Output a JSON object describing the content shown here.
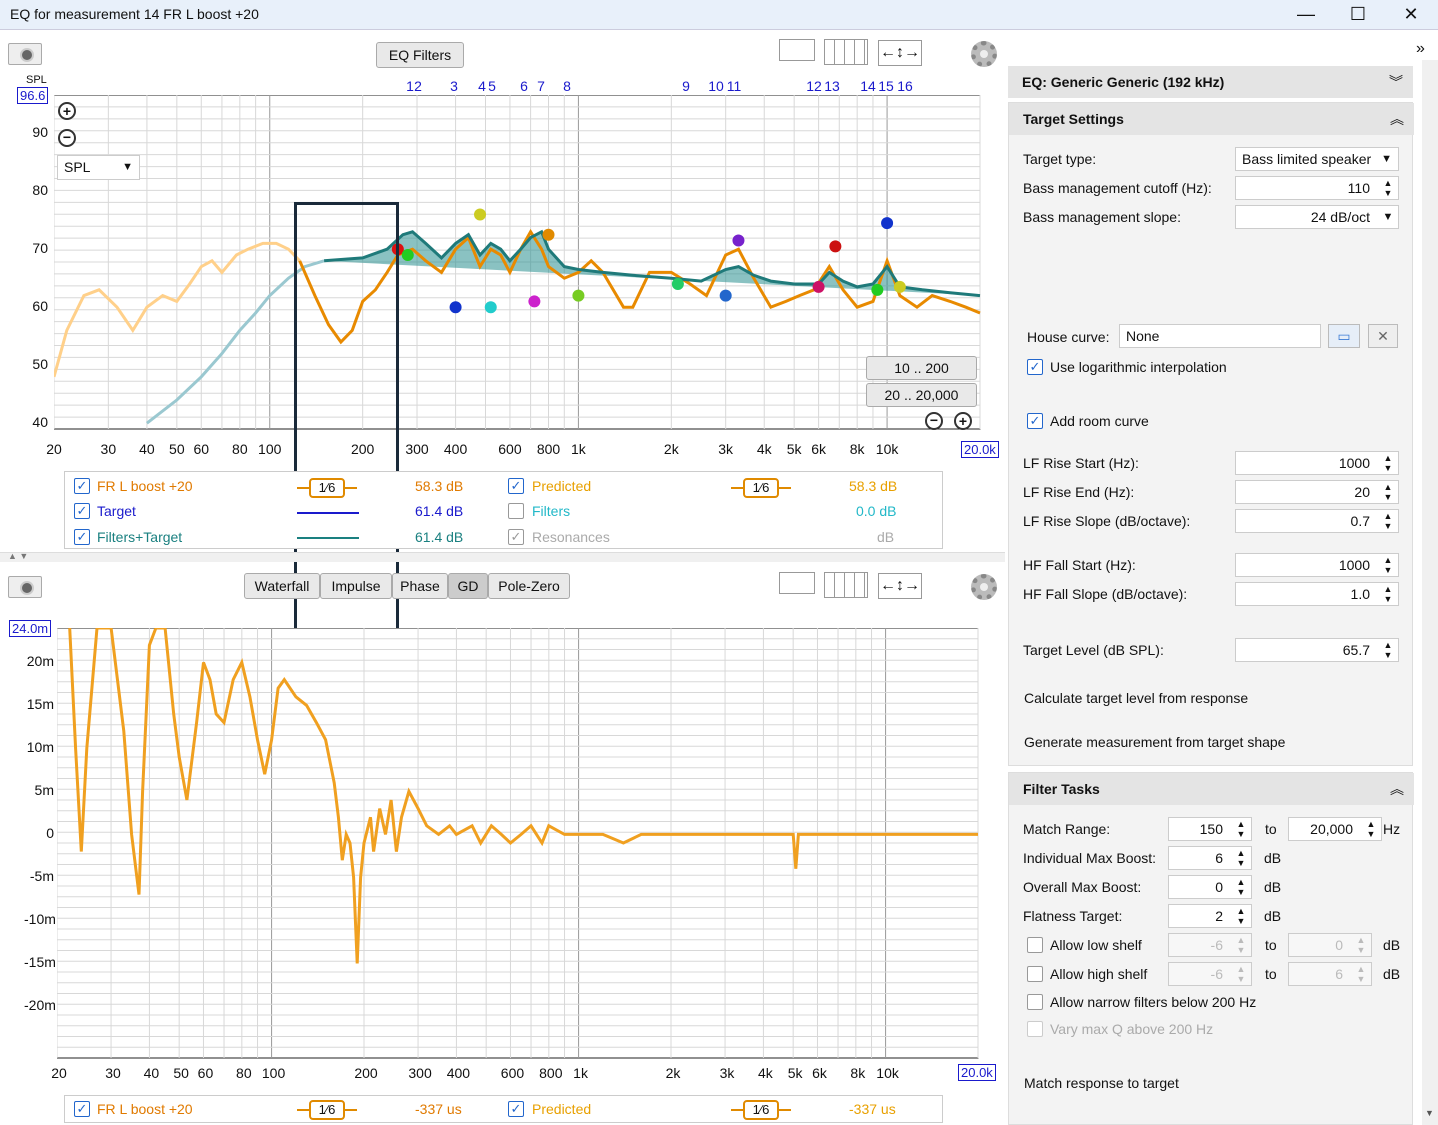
{
  "window": {
    "title": "EQ for measurement 14 FR L boost +20",
    "min": "—",
    "max": "☐",
    "close": "✕"
  },
  "top": {
    "eq_filters": "EQ Filters",
    "spl_dropdown": "SPL",
    "spl_axis_top": "96.6",
    "spl_unit": "SPL",
    "y_ticks": [
      "90",
      "80",
      "70",
      "60",
      "50",
      "40"
    ],
    "x_ticks": [
      "20",
      "30",
      "40",
      "50",
      "60",
      "80",
      "100",
      "200",
      "300",
      "400",
      "600",
      "800",
      "1k",
      "2k",
      "3k",
      "4k",
      "5k",
      "6k",
      "8k",
      "10k"
    ],
    "x_end": "20.0k",
    "filter_numbers": [
      "1",
      "2",
      "3",
      "4",
      "5",
      "6",
      "7",
      "8",
      "9",
      "10",
      "11",
      "12",
      "13",
      "14",
      "15",
      "16"
    ],
    "range_a": "10 .. 200",
    "range_b": "20 .. 20,000"
  },
  "top_legend": [
    {
      "label": "FR L boost +20",
      "checked": true,
      "smoothing": "1⁄6",
      "value": "58.3 dB",
      "color": "#e07a00"
    },
    {
      "label": "Target",
      "checked": true,
      "value": "61.4 dB",
      "color": "#1a1acc"
    },
    {
      "label": "Filters+Target",
      "checked": true,
      "value": "61.4 dB",
      "color": "#1a8080"
    },
    {
      "label": "Predicted",
      "checked": true,
      "smoothing": "1⁄6",
      "value": "58.3 dB",
      "color": "#e8a000"
    },
    {
      "label": "Filters",
      "checked": false,
      "value": "0.0 dB",
      "color": "#22b8c8"
    },
    {
      "label": "Resonances",
      "checked": true,
      "value": "dB",
      "color": "#aaaaaa"
    }
  ],
  "bottom": {
    "tabs": [
      "Waterfall",
      "Impulse",
      "Phase",
      "GD",
      "Pole-Zero"
    ],
    "active_tab": "GD",
    "y_axis_top": "24.0m",
    "y_ticks": [
      "20m",
      "15m",
      "10m",
      "5m",
      "0",
      "-5m",
      "-10m",
      "-15m",
      "-20m"
    ],
    "x_ticks": [
      "20",
      "30",
      "40",
      "50",
      "60",
      "80",
      "100",
      "200",
      "300",
      "400",
      "600",
      "800",
      "1k",
      "2k",
      "3k",
      "4k",
      "5k",
      "6k",
      "8k",
      "10k"
    ],
    "x_end": "20.0k"
  },
  "bottom_legend": [
    {
      "label": "FR L boost +20",
      "checked": true,
      "smoothing": "1⁄6",
      "value": "-337 us"
    },
    {
      "label": "Predicted",
      "checked": true,
      "smoothing": "1⁄6",
      "value": "-337 us"
    }
  ],
  "panel": {
    "eq_header": "EQ: Generic Generic (192 kHz)",
    "target_header": "Target Settings",
    "target_type_label": "Target type:",
    "target_type": "Bass limited speaker",
    "bm_cutoff_label": "Bass management cutoff (Hz):",
    "bm_cutoff": "110",
    "bm_slope_label": "Bass management slope:",
    "bm_slope": "24 dB/oct",
    "house_curve_label": "House curve:",
    "house_curve": "None",
    "log_interp": "Use logarithmic interpolation",
    "add_room": "Add room curve",
    "lf_rise_start_label": "LF Rise Start (Hz):",
    "lf_rise_start": "1000",
    "lf_rise_end_label": "LF Rise End (Hz):",
    "lf_rise_end": "20",
    "lf_rise_slope_label": "LF Rise Slope (dB/octave):",
    "lf_rise_slope": "0.7",
    "hf_fall_start_label": "HF Fall Start (Hz):",
    "hf_fall_start": "1000",
    "hf_fall_slope_label": "HF Fall Slope (dB/octave):",
    "hf_fall_slope": "1.0",
    "target_level_label": "Target Level (dB SPL):",
    "target_level": "65.7",
    "calc_target": "Calculate target level from response",
    "gen_meas": "Generate measurement from target shape",
    "filter_header": "Filter Tasks",
    "match_range_label": "Match Range:",
    "match_from": "150",
    "to": "to",
    "match_to": "20,000",
    "hz": "Hz",
    "ind_max_label": "Individual Max Boost:",
    "ind_max": "6",
    "db": "dB",
    "overall_max_label": "Overall Max Boost:",
    "overall_max": "0",
    "flatness_label": "Flatness Target:",
    "flatness": "2",
    "low_shelf": "Allow low shelf",
    "low_a": "-6",
    "low_b": "0",
    "high_shelf": "Allow high shelf",
    "high_a": "-6",
    "high_b": "6",
    "narrow": "Allow narrow filters below 200 Hz",
    "vary_q": "Vary max Q above 200 Hz",
    "match_resp": "Match response to target"
  }
}
